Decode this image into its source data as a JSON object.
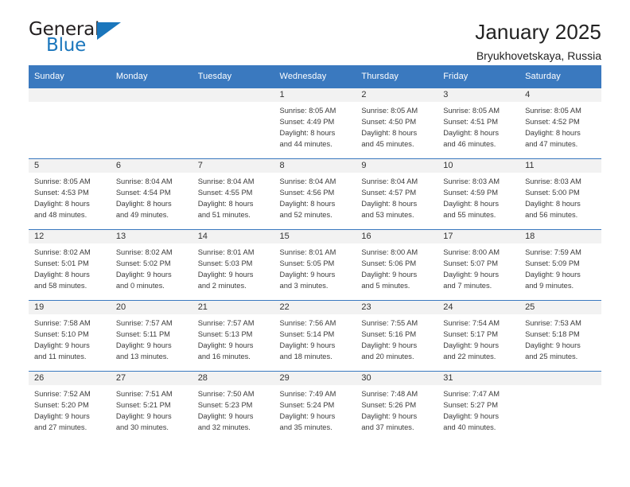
{
  "brand": {
    "name_top": "General",
    "name_bottom": "Blue",
    "color_dark": "#231f20",
    "color_blue": "#1a76bc"
  },
  "header": {
    "title": "January 2025",
    "subtitle": "Bryukhovetskaya, Russia"
  },
  "theme": {
    "header_bar": "#3a79bf",
    "day_band": "#f2f2f2",
    "text": "#3b3b3b"
  },
  "weekdays": [
    "Sunday",
    "Monday",
    "Tuesday",
    "Wednesday",
    "Thursday",
    "Friday",
    "Saturday"
  ],
  "weeks": [
    [
      {
        "day": "",
        "sunrise": "",
        "sunset": "",
        "daylight1": "",
        "daylight2": ""
      },
      {
        "day": "",
        "sunrise": "",
        "sunset": "",
        "daylight1": "",
        "daylight2": ""
      },
      {
        "day": "",
        "sunrise": "",
        "sunset": "",
        "daylight1": "",
        "daylight2": ""
      },
      {
        "day": "1",
        "sunrise": "Sunrise: 8:05 AM",
        "sunset": "Sunset: 4:49 PM",
        "daylight1": "Daylight: 8 hours",
        "daylight2": "and 44 minutes."
      },
      {
        "day": "2",
        "sunrise": "Sunrise: 8:05 AM",
        "sunset": "Sunset: 4:50 PM",
        "daylight1": "Daylight: 8 hours",
        "daylight2": "and 45 minutes."
      },
      {
        "day": "3",
        "sunrise": "Sunrise: 8:05 AM",
        "sunset": "Sunset: 4:51 PM",
        "daylight1": "Daylight: 8 hours",
        "daylight2": "and 46 minutes."
      },
      {
        "day": "4",
        "sunrise": "Sunrise: 8:05 AM",
        "sunset": "Sunset: 4:52 PM",
        "daylight1": "Daylight: 8 hours",
        "daylight2": "and 47 minutes."
      }
    ],
    [
      {
        "day": "5",
        "sunrise": "Sunrise: 8:05 AM",
        "sunset": "Sunset: 4:53 PM",
        "daylight1": "Daylight: 8 hours",
        "daylight2": "and 48 minutes."
      },
      {
        "day": "6",
        "sunrise": "Sunrise: 8:04 AM",
        "sunset": "Sunset: 4:54 PM",
        "daylight1": "Daylight: 8 hours",
        "daylight2": "and 49 minutes."
      },
      {
        "day": "7",
        "sunrise": "Sunrise: 8:04 AM",
        "sunset": "Sunset: 4:55 PM",
        "daylight1": "Daylight: 8 hours",
        "daylight2": "and 51 minutes."
      },
      {
        "day": "8",
        "sunrise": "Sunrise: 8:04 AM",
        "sunset": "Sunset: 4:56 PM",
        "daylight1": "Daylight: 8 hours",
        "daylight2": "and 52 minutes."
      },
      {
        "day": "9",
        "sunrise": "Sunrise: 8:04 AM",
        "sunset": "Sunset: 4:57 PM",
        "daylight1": "Daylight: 8 hours",
        "daylight2": "and 53 minutes."
      },
      {
        "day": "10",
        "sunrise": "Sunrise: 8:03 AM",
        "sunset": "Sunset: 4:59 PM",
        "daylight1": "Daylight: 8 hours",
        "daylight2": "and 55 minutes."
      },
      {
        "day": "11",
        "sunrise": "Sunrise: 8:03 AM",
        "sunset": "Sunset: 5:00 PM",
        "daylight1": "Daylight: 8 hours",
        "daylight2": "and 56 minutes."
      }
    ],
    [
      {
        "day": "12",
        "sunrise": "Sunrise: 8:02 AM",
        "sunset": "Sunset: 5:01 PM",
        "daylight1": "Daylight: 8 hours",
        "daylight2": "and 58 minutes."
      },
      {
        "day": "13",
        "sunrise": "Sunrise: 8:02 AM",
        "sunset": "Sunset: 5:02 PM",
        "daylight1": "Daylight: 9 hours",
        "daylight2": "and 0 minutes."
      },
      {
        "day": "14",
        "sunrise": "Sunrise: 8:01 AM",
        "sunset": "Sunset: 5:03 PM",
        "daylight1": "Daylight: 9 hours",
        "daylight2": "and 2 minutes."
      },
      {
        "day": "15",
        "sunrise": "Sunrise: 8:01 AM",
        "sunset": "Sunset: 5:05 PM",
        "daylight1": "Daylight: 9 hours",
        "daylight2": "and 3 minutes."
      },
      {
        "day": "16",
        "sunrise": "Sunrise: 8:00 AM",
        "sunset": "Sunset: 5:06 PM",
        "daylight1": "Daylight: 9 hours",
        "daylight2": "and 5 minutes."
      },
      {
        "day": "17",
        "sunrise": "Sunrise: 8:00 AM",
        "sunset": "Sunset: 5:07 PM",
        "daylight1": "Daylight: 9 hours",
        "daylight2": "and 7 minutes."
      },
      {
        "day": "18",
        "sunrise": "Sunrise: 7:59 AM",
        "sunset": "Sunset: 5:09 PM",
        "daylight1": "Daylight: 9 hours",
        "daylight2": "and 9 minutes."
      }
    ],
    [
      {
        "day": "19",
        "sunrise": "Sunrise: 7:58 AM",
        "sunset": "Sunset: 5:10 PM",
        "daylight1": "Daylight: 9 hours",
        "daylight2": "and 11 minutes."
      },
      {
        "day": "20",
        "sunrise": "Sunrise: 7:57 AM",
        "sunset": "Sunset: 5:11 PM",
        "daylight1": "Daylight: 9 hours",
        "daylight2": "and 13 minutes."
      },
      {
        "day": "21",
        "sunrise": "Sunrise: 7:57 AM",
        "sunset": "Sunset: 5:13 PM",
        "daylight1": "Daylight: 9 hours",
        "daylight2": "and 16 minutes."
      },
      {
        "day": "22",
        "sunrise": "Sunrise: 7:56 AM",
        "sunset": "Sunset: 5:14 PM",
        "daylight1": "Daylight: 9 hours",
        "daylight2": "and 18 minutes."
      },
      {
        "day": "23",
        "sunrise": "Sunrise: 7:55 AM",
        "sunset": "Sunset: 5:16 PM",
        "daylight1": "Daylight: 9 hours",
        "daylight2": "and 20 minutes."
      },
      {
        "day": "24",
        "sunrise": "Sunrise: 7:54 AM",
        "sunset": "Sunset: 5:17 PM",
        "daylight1": "Daylight: 9 hours",
        "daylight2": "and 22 minutes."
      },
      {
        "day": "25",
        "sunrise": "Sunrise: 7:53 AM",
        "sunset": "Sunset: 5:18 PM",
        "daylight1": "Daylight: 9 hours",
        "daylight2": "and 25 minutes."
      }
    ],
    [
      {
        "day": "26",
        "sunrise": "Sunrise: 7:52 AM",
        "sunset": "Sunset: 5:20 PM",
        "daylight1": "Daylight: 9 hours",
        "daylight2": "and 27 minutes."
      },
      {
        "day": "27",
        "sunrise": "Sunrise: 7:51 AM",
        "sunset": "Sunset: 5:21 PM",
        "daylight1": "Daylight: 9 hours",
        "daylight2": "and 30 minutes."
      },
      {
        "day": "28",
        "sunrise": "Sunrise: 7:50 AM",
        "sunset": "Sunset: 5:23 PM",
        "daylight1": "Daylight: 9 hours",
        "daylight2": "and 32 minutes."
      },
      {
        "day": "29",
        "sunrise": "Sunrise: 7:49 AM",
        "sunset": "Sunset: 5:24 PM",
        "daylight1": "Daylight: 9 hours",
        "daylight2": "and 35 minutes."
      },
      {
        "day": "30",
        "sunrise": "Sunrise: 7:48 AM",
        "sunset": "Sunset: 5:26 PM",
        "daylight1": "Daylight: 9 hours",
        "daylight2": "and 37 minutes."
      },
      {
        "day": "31",
        "sunrise": "Sunrise: 7:47 AM",
        "sunset": "Sunset: 5:27 PM",
        "daylight1": "Daylight: 9 hours",
        "daylight2": "and 40 minutes."
      },
      {
        "day": "",
        "sunrise": "",
        "sunset": "",
        "daylight1": "",
        "daylight2": ""
      }
    ]
  ]
}
